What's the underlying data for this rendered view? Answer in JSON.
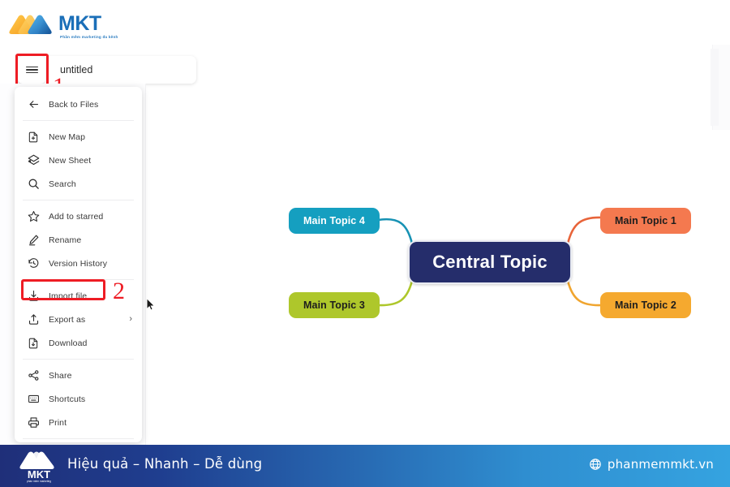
{
  "brand": {
    "logo_text": "MKT",
    "logo_tagline": "Phần mềm marketing đa kênh"
  },
  "titlebar": {
    "menu_button_icon": "hamburger-icon",
    "document_name": "untitled",
    "document_name_placeholder": "untitled"
  },
  "annotations": [
    {
      "number": "1",
      "target": "hamburger-menu-button"
    },
    {
      "number": "2",
      "target": "import-file-menu-item"
    }
  ],
  "menu": {
    "groups": [
      {
        "items": [
          {
            "label": "Back to Files",
            "icon": "arrow-left-icon",
            "name": "back-to-files"
          }
        ]
      },
      {
        "items": [
          {
            "label": "New Map",
            "icon": "file-plus-icon",
            "name": "new-map"
          },
          {
            "label": "New Sheet",
            "icon": "layers-plus-icon",
            "name": "new-sheet"
          },
          {
            "label": "Search",
            "icon": "search-icon",
            "name": "search"
          }
        ]
      },
      {
        "items": [
          {
            "label": "Add to starred",
            "icon": "star-icon",
            "name": "add-to-starred"
          },
          {
            "label": "Rename",
            "icon": "pencil-icon",
            "name": "rename"
          },
          {
            "label": "Version History",
            "icon": "history-icon",
            "name": "version-history"
          }
        ]
      },
      {
        "items": [
          {
            "label": "Import file",
            "icon": "import-icon",
            "name": "import-file",
            "highlighted": true
          },
          {
            "label": "Export as",
            "icon": "export-icon",
            "name": "export-as",
            "submenu": "›"
          },
          {
            "label": "Download",
            "icon": "download-file-icon",
            "name": "download"
          }
        ]
      },
      {
        "items": [
          {
            "label": "Share",
            "icon": "share-icon",
            "name": "share"
          },
          {
            "label": "Shortcuts",
            "icon": "keyboard-icon",
            "name": "shortcuts"
          },
          {
            "label": "Print",
            "icon": "printer-icon",
            "name": "print"
          }
        ]
      }
    ]
  },
  "mindmap": {
    "central": {
      "label": "Central Topic",
      "color": "#252d6b",
      "text_color": "#ffffff"
    },
    "branches": [
      {
        "label": "Main Topic 1",
        "color": "#f4794f",
        "text_color": "#1d1d1d",
        "side": "right"
      },
      {
        "label": "Main Topic 2",
        "color": "#f5a92f",
        "text_color": "#1d1d1d",
        "side": "right"
      },
      {
        "label": "Main Topic 3",
        "color": "#aec72b",
        "text_color": "#1d1d1d",
        "side": "left"
      },
      {
        "label": "Main Topic 4",
        "color": "#159fc0",
        "text_color": "#ffffff",
        "side": "left"
      }
    ]
  },
  "footer": {
    "logo_text": "MKT",
    "slogan": "Hiệu quả – Nhanh  – Dễ dùng",
    "website": "phanmemmkt.vn",
    "globe_icon": "globe-icon",
    "accent_start": "#1f2f79",
    "accent_end": "#35a3e0"
  }
}
